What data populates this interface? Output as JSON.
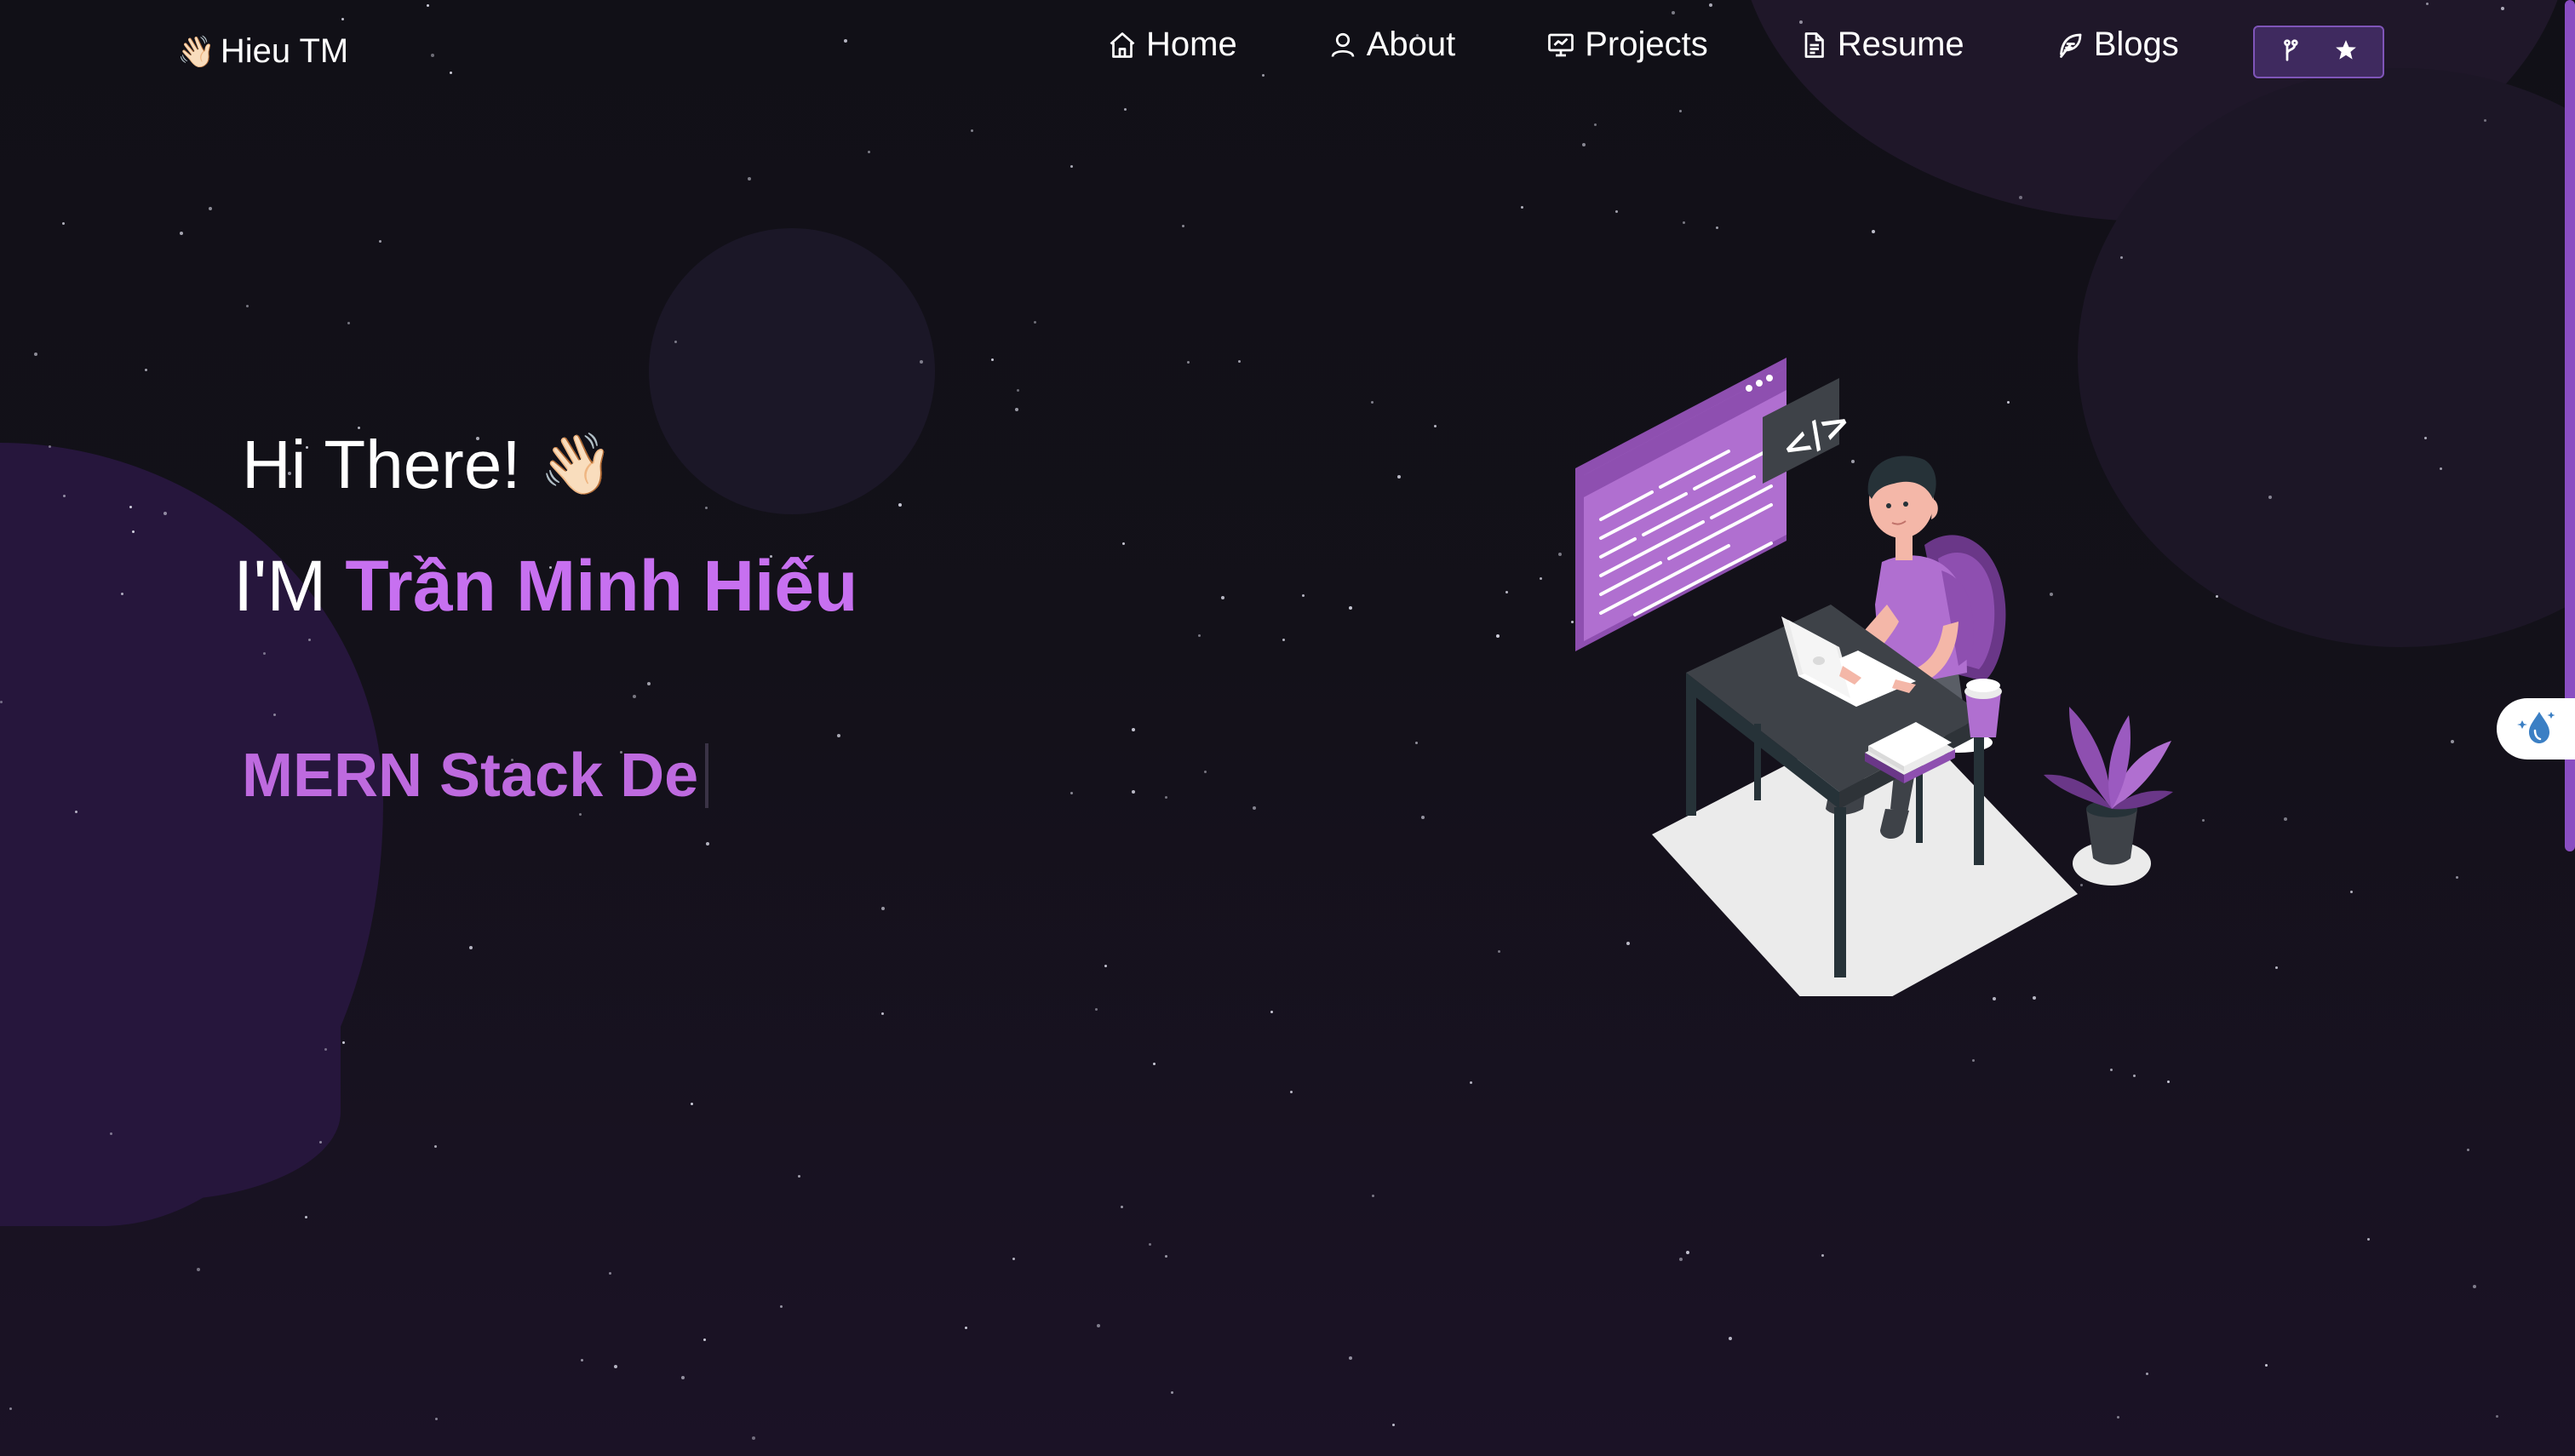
{
  "brand": {
    "icon": "👋🏻",
    "name": "Hieu TM"
  },
  "nav": {
    "items": [
      {
        "label": "Home",
        "icon": "home-icon"
      },
      {
        "label": "About",
        "icon": "user-icon"
      },
      {
        "label": "Projects",
        "icon": "presentation-icon"
      },
      {
        "label": "Resume",
        "icon": "document-icon"
      },
      {
        "label": "Blogs",
        "icon": "feather-icon"
      }
    ],
    "github_button": {
      "icons": [
        "git-fork-icon",
        "star-icon"
      ]
    }
  },
  "hero": {
    "greeting": "Hi There!",
    "wave_emoji": "👋🏻",
    "intro_prefix": "I'M",
    "name": "Trần Minh Hiếu",
    "typewriter_text": "MERN Stack De"
  },
  "illustration": {
    "code_tag": "</>"
  },
  "colors": {
    "background": "#0f0f14",
    "accent_purple": "#c770f0",
    "typewriter_purple": "#be6adf",
    "button_purple": "#3f2a5f",
    "scrollbar": "#8a4ec2"
  }
}
